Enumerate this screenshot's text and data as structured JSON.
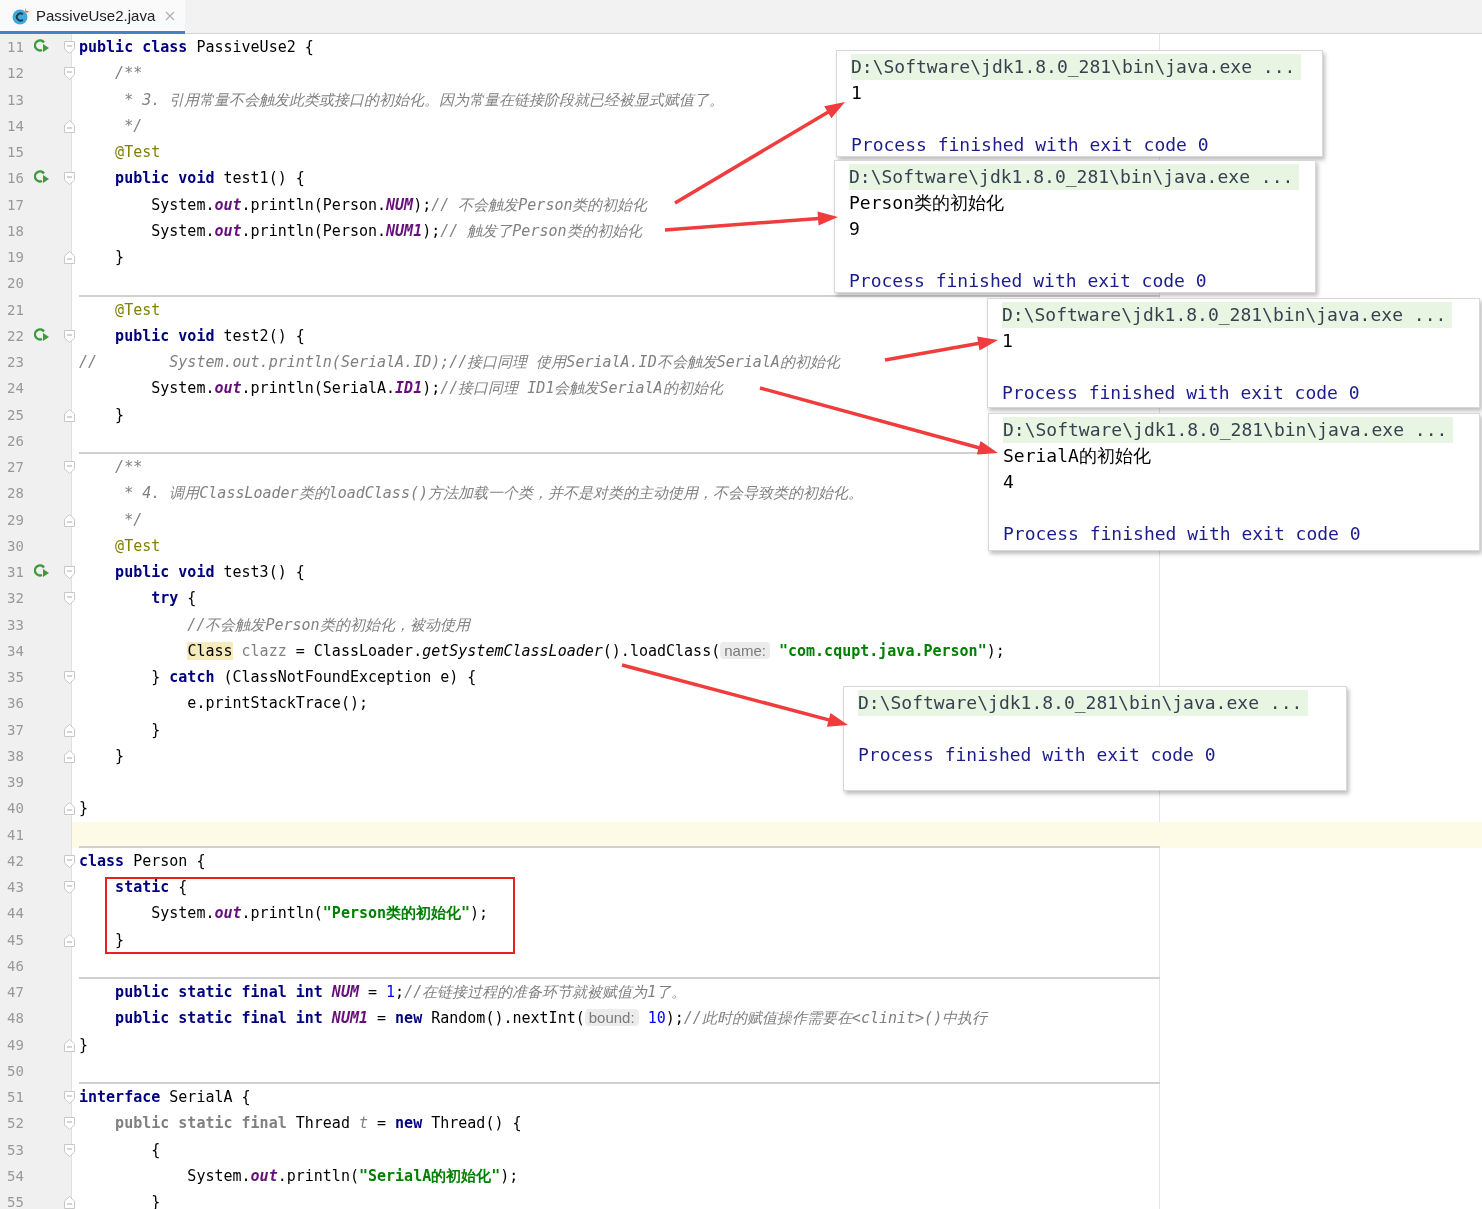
{
  "tab": {
    "label": "PassiveUse2.java",
    "selected": true
  },
  "lines": [
    {
      "number": "11",
      "run": true,
      "fold_open": true,
      "tokens": [
        {
          "kind": "kw",
          "text": "public class"
        },
        {
          "kind": "plain",
          "text": " PassiveUse2 {"
        }
      ]
    },
    {
      "number": "12",
      "fold_open": true,
      "tokens": [
        {
          "kind": "doc",
          "text": "    /**"
        }
      ]
    },
    {
      "number": "13",
      "tokens": [
        {
          "kind": "doc",
          "text": "     * 3. 引用常量不会触发此类或接口的初始化。因为常量在链接阶段就已经被显式赋值了。"
        }
      ]
    },
    {
      "number": "14",
      "fold_close": true,
      "tokens": [
        {
          "kind": "doc",
          "text": "     */"
        }
      ]
    },
    {
      "number": "15",
      "tokens": [
        {
          "kind": "annot",
          "text": "    @Test"
        }
      ]
    },
    {
      "number": "16",
      "run": true,
      "fold_open": true,
      "tokens": [
        {
          "kind": "kw",
          "text": "    public void"
        },
        {
          "kind": "plain",
          "text": " test1() {"
        }
      ]
    },
    {
      "number": "17",
      "tokens": [
        {
          "kind": "plain",
          "text": "        System."
        },
        {
          "kind": "field",
          "text": "out"
        },
        {
          "kind": "plain",
          "text": ".println(Person."
        },
        {
          "kind": "field",
          "text": "NUM"
        },
        {
          "kind": "plain",
          "text": ");"
        },
        {
          "kind": "comment",
          "text": "// 不会触发Person类的初始化"
        }
      ]
    },
    {
      "number": "18",
      "tokens": [
        {
          "kind": "plain",
          "text": "        System."
        },
        {
          "kind": "field",
          "text": "out"
        },
        {
          "kind": "plain",
          "text": ".println(Person."
        },
        {
          "kind": "field",
          "text": "NUM1"
        },
        {
          "kind": "plain",
          "text": ");"
        },
        {
          "kind": "comment",
          "text": "// 触发了Person类的初始化"
        }
      ]
    },
    {
      "number": "19",
      "fold_close": true,
      "tokens": [
        {
          "kind": "plain",
          "text": "    }"
        }
      ]
    },
    {
      "number": "20",
      "separator": true
    },
    {
      "number": "21",
      "tokens": [
        {
          "kind": "annot",
          "text": "    @Test"
        }
      ]
    },
    {
      "number": "22",
      "run": true,
      "fold_open": true,
      "tokens": [
        {
          "kind": "kw",
          "text": "    public void"
        },
        {
          "kind": "plain",
          "text": " test2() {"
        }
      ]
    },
    {
      "number": "23",
      "tokens": [
        {
          "kind": "comment",
          "text": "//        System.out.println(SerialA.ID);//接口同理 使用SerialA.ID不会触发SerialA的初始化"
        }
      ]
    },
    {
      "number": "24",
      "tokens": [
        {
          "kind": "plain",
          "text": "        System."
        },
        {
          "kind": "field",
          "text": "out"
        },
        {
          "kind": "plain",
          "text": ".println(SerialA."
        },
        {
          "kind": "field",
          "text": "ID1"
        },
        {
          "kind": "plain",
          "text": ");"
        },
        {
          "kind": "comment",
          "text": "//接口同理 ID1会触发SerialA的初始化"
        }
      ]
    },
    {
      "number": "25",
      "fold_close": true,
      "tokens": [
        {
          "kind": "plain",
          "text": "    }"
        }
      ]
    },
    {
      "number": "26",
      "separator": true
    },
    {
      "number": "27",
      "fold_open": true,
      "tokens": [
        {
          "kind": "doc",
          "text": "    /**"
        }
      ]
    },
    {
      "number": "28",
      "tokens": [
        {
          "kind": "doc",
          "text": "     * 4. 调用ClassLoader类的loadClass()方法加载一个类，并不是对类的主动使用，不会导致类的初始化。"
        }
      ]
    },
    {
      "number": "29",
      "fold_close": true,
      "tokens": [
        {
          "kind": "doc",
          "text": "     */"
        }
      ]
    },
    {
      "number": "30",
      "tokens": [
        {
          "kind": "annot",
          "text": "    @Test"
        }
      ]
    },
    {
      "number": "31",
      "run": true,
      "fold_open": true,
      "tokens": [
        {
          "kind": "kw",
          "text": "    public void"
        },
        {
          "kind": "plain",
          "text": " test3() {"
        }
      ]
    },
    {
      "number": "32",
      "fold_open": true,
      "tokens": [
        {
          "kind": "kw",
          "text": "        try"
        },
        {
          "kind": "plain",
          "text": " {"
        }
      ]
    },
    {
      "number": "33",
      "tokens": [
        {
          "kind": "comment",
          "text": "            //不会触发Person类的初始化，被动使用"
        }
      ]
    },
    {
      "number": "34",
      "tokens": [
        {
          "kind": "mark",
          "text": "            Class"
        },
        {
          "kind": "unused",
          "text": " clazz"
        },
        {
          "kind": "plain",
          "text": " = ClassLoader."
        },
        {
          "kind": "static",
          "text": "getSystemClassLoader"
        },
        {
          "kind": "plain",
          "text": "().loadClass("
        },
        {
          "kind": "hint",
          "text": "name:"
        },
        {
          "kind": "string",
          "text": " \"com.cqupt.java.Person\""
        },
        {
          "kind": "plain",
          "text": ");"
        }
      ]
    },
    {
      "number": "35",
      "fold_open": true,
      "tokens": [
        {
          "kind": "plain",
          "text": "        } "
        },
        {
          "kind": "kw",
          "text": "catch"
        },
        {
          "kind": "plain",
          "text": " (ClassNotFoundException e) {"
        }
      ]
    },
    {
      "number": "36",
      "tokens": [
        {
          "kind": "plain",
          "text": "            e.printStackTrace();"
        }
      ]
    },
    {
      "number": "37",
      "fold_close": true,
      "tokens": [
        {
          "kind": "plain",
          "text": "        }"
        }
      ]
    },
    {
      "number": "38",
      "fold_close": true,
      "tokens": [
        {
          "kind": "plain",
          "text": "    }"
        }
      ]
    },
    {
      "number": "39"
    },
    {
      "number": "40",
      "fold_close": true,
      "tokens": [
        {
          "kind": "plain",
          "text": "}"
        }
      ]
    },
    {
      "number": "41",
      "current": true,
      "separator": true
    },
    {
      "number": "42",
      "fold_open": true,
      "tokens": [
        {
          "kind": "kw",
          "text": "class"
        },
        {
          "kind": "plain",
          "text": " Person {"
        }
      ]
    },
    {
      "number": "43",
      "fold_open": true,
      "tokens": [
        {
          "kind": "kw",
          "text": "    static"
        },
        {
          "kind": "plain",
          "text": " {"
        }
      ]
    },
    {
      "number": "44",
      "tokens": [
        {
          "kind": "plain",
          "text": "        System."
        },
        {
          "kind": "field",
          "text": "out"
        },
        {
          "kind": "plain",
          "text": ".println("
        },
        {
          "kind": "string",
          "text": "\"Person类的初始化\""
        },
        {
          "kind": "plain",
          "text": ");"
        }
      ]
    },
    {
      "number": "45",
      "fold_close": true,
      "tokens": [
        {
          "kind": "plain",
          "text": "    }"
        }
      ]
    },
    {
      "number": "46",
      "separator": true
    },
    {
      "number": "47",
      "tokens": [
        {
          "kind": "kw",
          "text": "    public static final int"
        },
        {
          "kind": "field",
          "text": " NUM"
        },
        {
          "kind": "plain",
          "text": " = "
        },
        {
          "kind": "num",
          "text": "1"
        },
        {
          "kind": "plain",
          "text": ";"
        },
        {
          "kind": "comment",
          "text": "//在链接过程的准备环节就被赋值为1了。"
        }
      ]
    },
    {
      "number": "48",
      "tokens": [
        {
          "kind": "kw",
          "text": "    public static final int"
        },
        {
          "kind": "field",
          "text": " NUM1"
        },
        {
          "kind": "plain",
          "text": " = "
        },
        {
          "kind": "kw",
          "text": "new"
        },
        {
          "kind": "plain",
          "text": " Random().nextInt("
        },
        {
          "kind": "hint",
          "text": "bound:"
        },
        {
          "kind": "num",
          "text": " 10"
        },
        {
          "kind": "plain",
          "text": ");"
        },
        {
          "kind": "comment",
          "text": "//此时的赋值操作需要在<clinit>()中执行"
        }
      ]
    },
    {
      "number": "49",
      "fold_close": true,
      "tokens": [
        {
          "kind": "plain",
          "text": "}"
        }
      ]
    },
    {
      "number": "50",
      "separator": true
    },
    {
      "number": "51",
      "fold_open": true,
      "tokens": [
        {
          "kind": "kw",
          "text": "interface"
        },
        {
          "kind": "plain",
          "text": " SerialA {"
        }
      ]
    },
    {
      "number": "52",
      "fold_open": true,
      "tokens": [
        {
          "kind": "dimkw",
          "text": "    public static final"
        },
        {
          "kind": "plain",
          "text": " Thread "
        },
        {
          "kind": "dimfield",
          "text": "t"
        },
        {
          "kind": "plain",
          "text": " = "
        },
        {
          "kind": "kw",
          "text": "new"
        },
        {
          "kind": "plain",
          "text": " Thread() {"
        }
      ]
    },
    {
      "number": "53",
      "fold_open": true,
      "tokens": [
        {
          "kind": "plain",
          "text": "        {"
        }
      ]
    },
    {
      "number": "54",
      "tokens": [
        {
          "kind": "plain",
          "text": "            System."
        },
        {
          "kind": "field",
          "text": "out"
        },
        {
          "kind": "plain",
          "text": ".println("
        },
        {
          "kind": "string",
          "text": "\"SerialA的初始化\""
        },
        {
          "kind": "plain",
          "text": ");"
        }
      ]
    },
    {
      "number": "55",
      "fold_close": true,
      "tokens": [
        {
          "kind": "plain",
          "text": "        }"
        }
      ]
    }
  ],
  "outputs": [
    {
      "lines": [
        {
          "kind": "command",
          "text": "D:\\Software\\jdk1.8.0_281\\bin\\java.exe ..."
        },
        {
          "kind": "output",
          "text": "1"
        },
        {
          "kind": "blank"
        },
        {
          "kind": "exit",
          "text": "Process finished with exit code 0"
        }
      ]
    },
    {
      "lines": [
        {
          "kind": "command",
          "text": "D:\\Software\\jdk1.8.0_281\\bin\\java.exe ..."
        },
        {
          "kind": "output",
          "text": "Person类的初始化"
        },
        {
          "kind": "output",
          "text": "9"
        },
        {
          "kind": "blank"
        },
        {
          "kind": "exit",
          "text": "Process finished with exit code 0"
        }
      ]
    },
    {
      "lines": [
        {
          "kind": "command",
          "text": "D:\\Software\\jdk1.8.0_281\\bin\\java.exe ..."
        },
        {
          "kind": "output",
          "text": "1"
        },
        {
          "kind": "blank"
        },
        {
          "kind": "exit",
          "text": "Process finished with exit code 0"
        }
      ]
    },
    {
      "lines": [
        {
          "kind": "command",
          "text": "D:\\Software\\jdk1.8.0_281\\bin\\java.exe ..."
        },
        {
          "kind": "output",
          "text": "SerialA的初始化"
        },
        {
          "kind": "output",
          "text": "4"
        },
        {
          "kind": "blank"
        },
        {
          "kind": "exit",
          "text": "Process finished with exit code 0"
        }
      ]
    },
    {
      "lines": [
        {
          "kind": "command",
          "text": "D:\\Software\\jdk1.8.0_281\\bin\\java.exe ..."
        },
        {
          "kind": "blank"
        },
        {
          "kind": "exit",
          "text": "Process finished with exit code 0"
        }
      ]
    }
  ]
}
